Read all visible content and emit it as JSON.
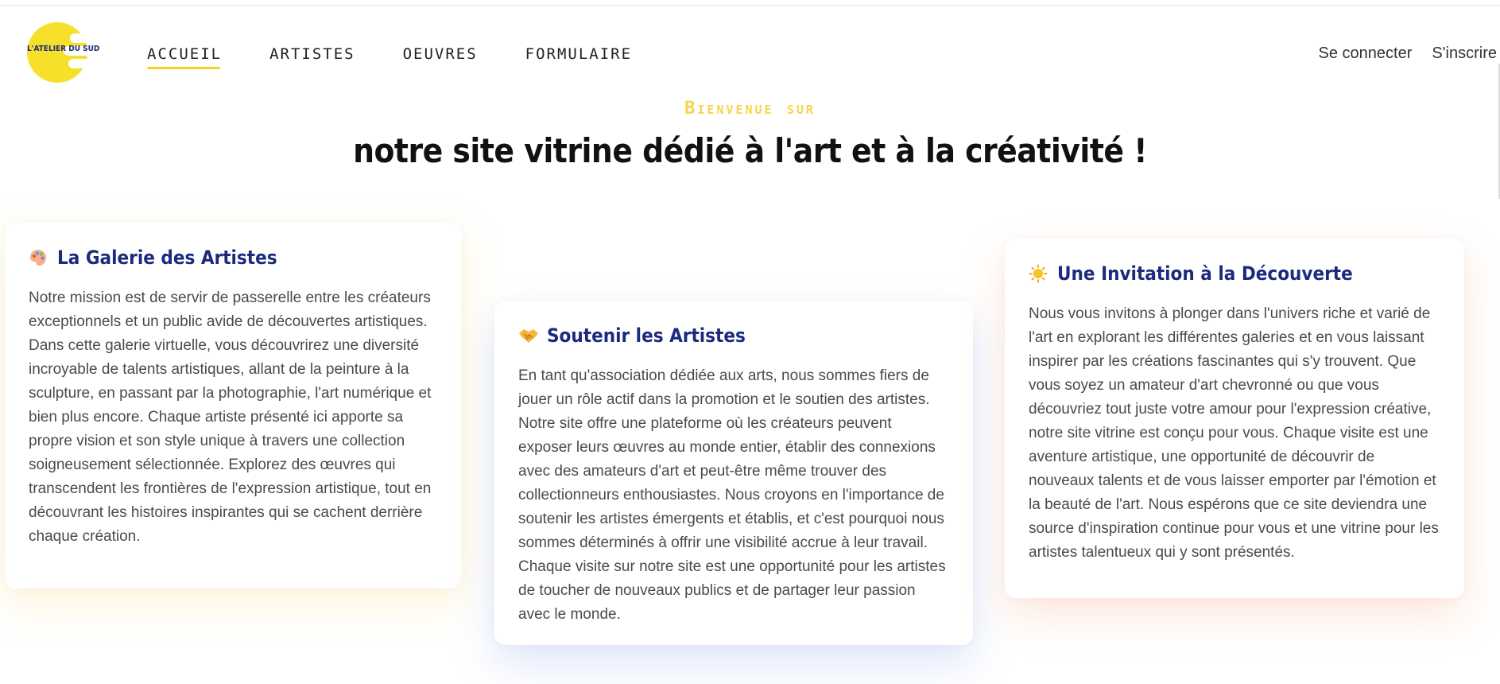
{
  "brand": {
    "logo_text": "L'ATELIER DU SUD",
    "accent_yellow": "#f7e02a",
    "navy": "#1c2a7d"
  },
  "nav": {
    "items": [
      {
        "label": "Accueil",
        "active": true
      },
      {
        "label": "Artistes",
        "active": false
      },
      {
        "label": "Oeuvres",
        "active": false
      },
      {
        "label": "Formulaire",
        "active": false
      }
    ],
    "login_label": "Se connecter",
    "signup_label": "S'inscrire"
  },
  "hero": {
    "kicker": "Bienvenue sur",
    "title": "notre site vitrine dédié à l'art et à la créativité !"
  },
  "cards": [
    {
      "icon": "palette-icon",
      "title": "La Galerie des Artistes",
      "body": "Notre mission est de servir de passerelle entre les créateurs exceptionnels et un public avide de découvertes artistiques. Dans cette galerie virtuelle, vous découvrirez une diversité incroyable de talents artistiques, allant de la peinture à la sculpture, en passant par la photographie, l'art numérique et bien plus encore. Chaque artiste présenté ici apporte sa propre vision et son style unique à travers une collection soigneusement sélectionnée. Explorez des œuvres qui transcendent les frontières de l'expression artistique, tout en découvrant les histoires inspirantes qui se cachent derrière chaque création."
    },
    {
      "icon": "handshake-icon",
      "title": "Soutenir les Artistes",
      "body": "En tant qu'association dédiée aux arts, nous sommes fiers de jouer un rôle actif dans la promotion et le soutien des artistes. Notre site offre une plateforme où les créateurs peuvent exposer leurs œuvres au monde entier, établir des connexions avec des amateurs d'art et peut-être même trouver des collectionneurs enthousiastes. Nous croyons en l'importance de soutenir les artistes émergents et établis, et c'est pourquoi nous sommes déterminés à offrir une visibilité accrue à leur travail. Chaque visite sur notre site est une opportunité pour les artistes de toucher de nouveaux publics et de partager leur passion avec le monde."
    },
    {
      "icon": "sun-icon",
      "title": "Une Invitation à la Découverte",
      "body": "Nous vous invitons à plonger dans l'univers riche et varié de l'art en explorant les différentes galeries et en vous laissant inspirer par les créations fascinantes qui s'y trouvent. Que vous soyez un amateur d'art chevronné ou que vous découvriez tout juste votre amour pour l'expression créative, notre site vitrine est conçu pour vous. Chaque visite est une aventure artistique, une opportunité de découvrir de nouveaux talents et de vous laisser emporter par l'émotion et la beauté de l'art. Nous espérons que ce site deviendra une source d'inspiration continue pour vous et une vitrine pour les artistes talentueux qui y sont présentés."
    }
  ]
}
